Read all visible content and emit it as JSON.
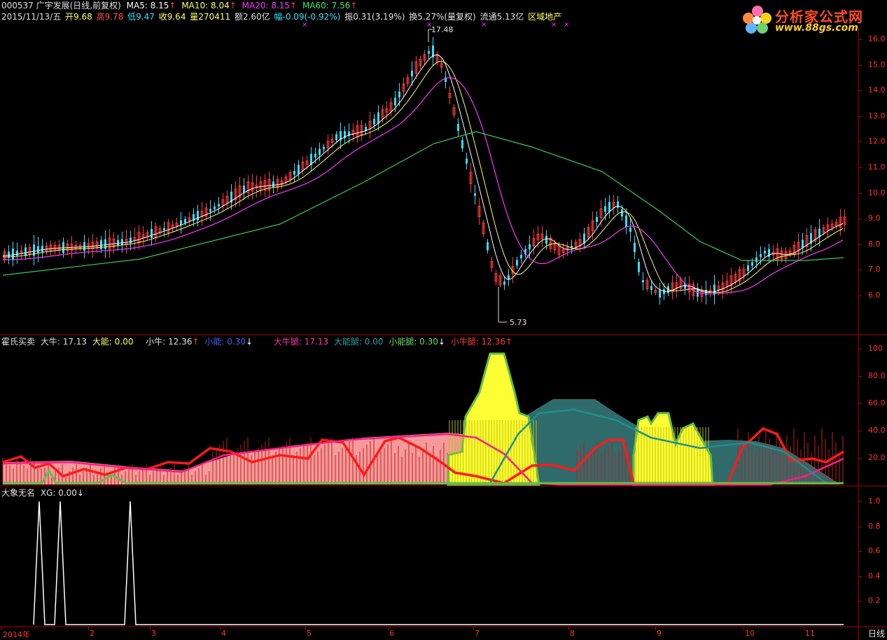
{
  "header": {
    "line1": {
      "code_name": "000537 广宇发展(日线,前复权)",
      "ma5": "MA5: 8.15",
      "ma10": "MA10: 8.04",
      "ma20": "MA20: 8.15",
      "ma60": "MA60: 7.56",
      "arrow_up": "↑"
    },
    "line2": {
      "date": "2015/11/13/五",
      "open": "开9.68",
      "high": "高9.78",
      "low": "低9.47",
      "close": "收9.64",
      "volume": "量270411",
      "amount": "额2.60亿",
      "change": "幅-0.09(-0.92%)",
      "amplitude": "振0.31(3.19%)",
      "turnover": "换5.27%(量复权)",
      "float": "流通5.13亿",
      "sector": "区域地产"
    }
  },
  "logo": {
    "title": "分析家公式网",
    "url": "www.88gs.com"
  },
  "main_chart": {
    "annot_high": "17.48",
    "annot_low": "5.73",
    "y_ticks": [
      "16.0",
      "15.0",
      "14.0",
      "13.0",
      "12.0",
      "11.0",
      "10.0",
      "9.0",
      "8.0",
      "7.0",
      "6.0"
    ],
    "colors": {
      "up": "#ff3b3b",
      "down": "#31e0ff",
      "ma5": "#ffffff",
      "ma10": "#ffff66",
      "ma20": "#ff33ff",
      "ma60": "#33cc66"
    }
  },
  "indicator": {
    "title": "霍氏买卖",
    "da_niu": "大牛: 17.13",
    "da_neng": "大能: 0.00",
    "xiao_niu": "小牛: 12.36",
    "xiao_neng": "小能: 0.30",
    "da_niu_tui": "大牛腿: 17.13",
    "da_neng_tui": "大能腿: 0.00",
    "xiao_neng_tui": "小能腿: 0.30",
    "xiao_niu_tui": "小牛腿: 12.36",
    "up_arrow": "↑",
    "down_arrow": "↓",
    "y_ticks": [
      "100",
      "80.0",
      "60.0",
      "40.0",
      "20.0"
    ]
  },
  "xg": {
    "title": "大象无名",
    "value": "XG: 0.00",
    "down_arrow": "↓",
    "y_ticks": [
      "1.0",
      "0.8",
      "0.6",
      "0.4",
      "0.2"
    ]
  },
  "x_axis": {
    "labels": [
      "2014年",
      "2",
      "3",
      "4",
      "5",
      "6",
      "7",
      "8",
      "9",
      "10",
      "11"
    ],
    "period": "日线"
  }
}
